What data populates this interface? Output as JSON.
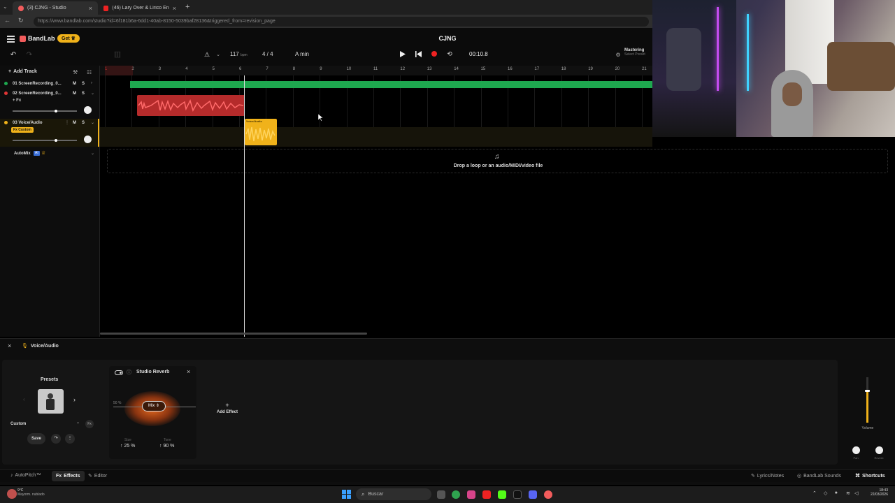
{
  "browser": {
    "tabs": [
      {
        "title": "(3) CJNG - Studio",
        "active": true
      },
      {
        "title": "(46) Lary Over & Lírico En la Casa",
        "active": false
      }
    ],
    "url": "https://www.bandlab.com/studio?id=6f181b6a-6dd1-40ab-8150-5039baf28136&triggered_from=revision_page"
  },
  "app": {
    "logo": "BandLab",
    "get_label": "Get",
    "project_title": "CJNG",
    "toolbar": {
      "bpm_value": "117",
      "bpm_unit": "bpm",
      "time_signature": "4 / 4",
      "key": "A min",
      "time_display": "00:10.8",
      "mastering_label": "Mastering",
      "mastering_sub": "Select Preset"
    },
    "add_track_label": "Add Track",
    "tracks": [
      {
        "name": "01 ScreenRecording_0...",
        "mute": "M",
        "solo": "S",
        "color": "#1ea84f"
      },
      {
        "name": "02 ScreenRecording_0...",
        "mute": "M",
        "solo": "S",
        "fx": "+ Fx",
        "color": "#e03535"
      },
      {
        "name": "03 Voice/Audio",
        "mute": "M",
        "solo": "S",
        "fx": "Fx Custom",
        "color": "#f0b21a"
      }
    ],
    "automix_label": "AutoMix",
    "automix_badge": "AI",
    "ruler_numbers": [
      "1",
      "2",
      "3",
      "4",
      "5",
      "6",
      "7",
      "8",
      "9",
      "10",
      "11",
      "12",
      "13",
      "14",
      "15",
      "16",
      "17",
      "18",
      "19",
      "20",
      "21"
    ],
    "voice_region_label": "Voice/Audio",
    "drop_text": "Drop a loop or an audio/MIDI/video file",
    "bottom": {
      "track_name": "Voice/Audio",
      "presets_label": "Presets",
      "preset_select": "Custom",
      "save_label": "Save",
      "effect": {
        "name": "Studio Reverb",
        "mix_label": "Mix",
        "mix_value": "50 %",
        "size_label": "Size",
        "size_value": "25 %",
        "tone_label": "Tone",
        "tone_value": "90 %"
      },
      "add_effect_label": "Add Effect",
      "volume_label": "Volume",
      "volume_level": 0.7,
      "pan_label": "Pan",
      "reverb_label": "Reverb"
    },
    "statusbar": {
      "autopitch": "AutoPitch™",
      "effects": "Effects",
      "editor": "Editor",
      "lyrics": "Lyrics/Notes",
      "sounds": "BandLab Sounds",
      "shortcuts": "Shortcuts"
    }
  },
  "taskbar": {
    "weather_temp": "9°C",
    "weather_desc": "Mayorm. nublado",
    "search_placeholder": "Buscar",
    "time": "18:43",
    "date": "22/03/2026"
  },
  "colors": {
    "accent": "#f0b21a",
    "green_track": "#1ea84f",
    "red_track": "#e03535",
    "brand": "#f25c5c"
  }
}
